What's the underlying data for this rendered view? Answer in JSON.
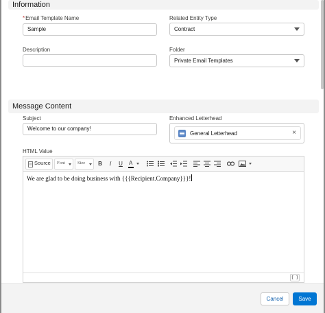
{
  "sections": {
    "information": "Information",
    "message_content": "Message Content"
  },
  "fields": {
    "template_name": {
      "label": "Email Template Name",
      "required_mark": "*",
      "value": "Sample"
    },
    "related_entity_type": {
      "label": "Related Entity Type",
      "value": "Contract"
    },
    "description": {
      "label": "Description",
      "value": ""
    },
    "folder": {
      "label": "Folder",
      "value": "Private Email Templates"
    },
    "subject": {
      "label": "Subject",
      "value": "Welcome to our company!"
    },
    "letterhead": {
      "label": "Enhanced Letterhead",
      "value": "General Letterhead",
      "clear_icon": "×"
    },
    "html_value": {
      "label": "HTML Value"
    }
  },
  "toolbar": {
    "source": "Source",
    "font": "Font",
    "size": "Size",
    "bold": "B",
    "italic": "I",
    "underline": "U",
    "text_color": "A",
    "insert_field": "{ }"
  },
  "editor": {
    "content": "We are glad to be doing business with {{{Recipient.Company}}}!"
  },
  "buttons": {
    "cancel": "Cancel",
    "save": "Save"
  },
  "colors": {
    "brand": "#0176d3",
    "required": "#c23934",
    "letterhead_icon": "#5a86c5"
  }
}
